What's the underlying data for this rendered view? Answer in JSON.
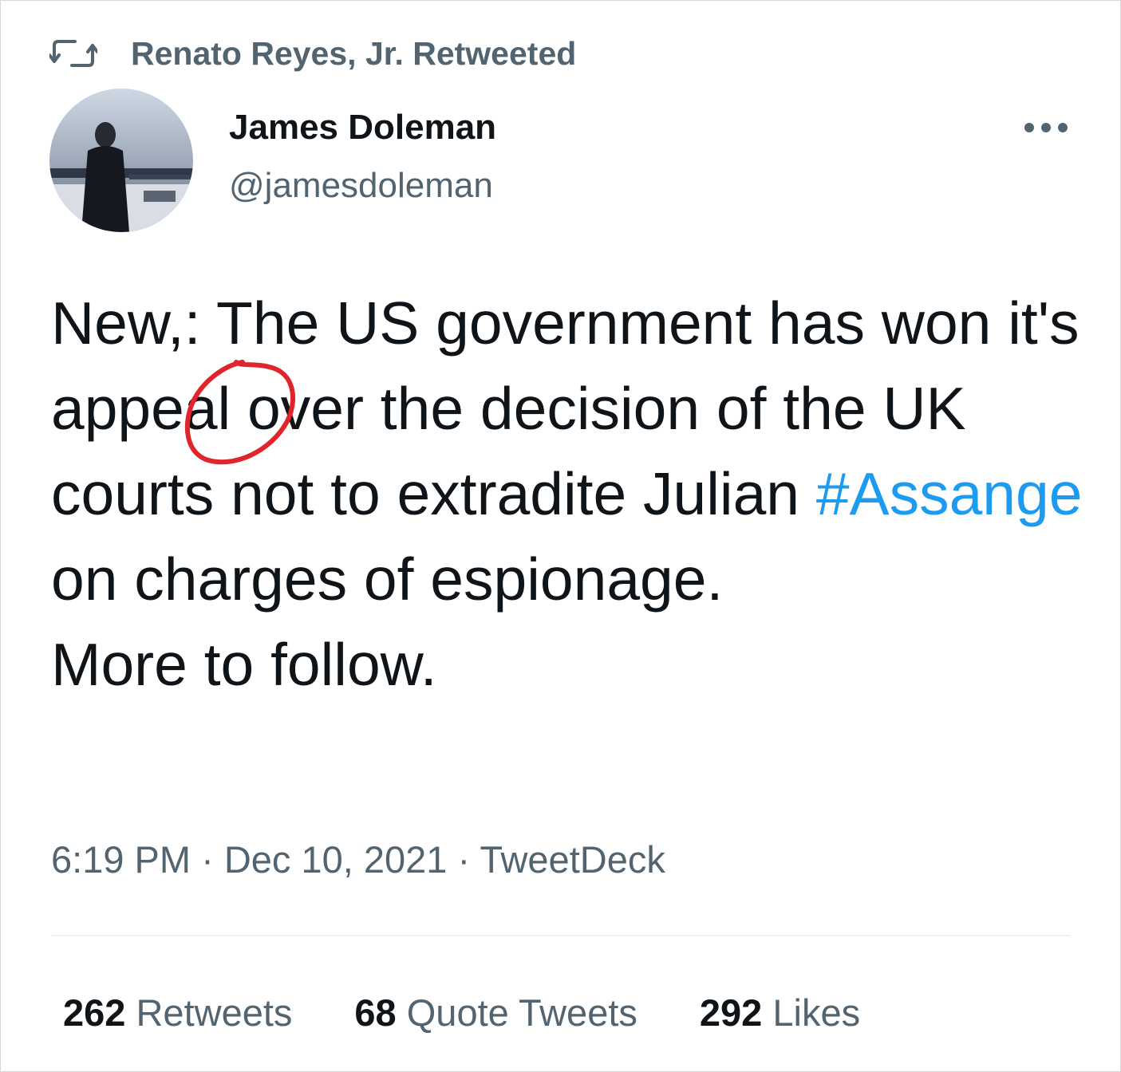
{
  "retweet": {
    "label": "Renato Reyes, Jr. Retweeted",
    "icon": "retweet-icon"
  },
  "author": {
    "name": "James Doleman",
    "handle": "@jamesdoleman"
  },
  "tweet": {
    "text_before_hashtag": "New,: The US government has won ",
    "highlighted_word": "it's",
    "text_after_highlight": " appeal over the decision of the UK courts not to extradite Julian ",
    "hashtag": "#Assange",
    "text_after_hashtag": " on charges of espionage.",
    "line2": "More to follow."
  },
  "meta": {
    "time": "6:19 PM",
    "date": "Dec 10, 2021",
    "source": "TweetDeck",
    "separator": "·"
  },
  "stats": [
    {
      "count": "262",
      "label": "Retweets"
    },
    {
      "count": "68",
      "label": "Quote Tweets"
    },
    {
      "count": "292",
      "label": "Likes"
    }
  ],
  "colors": {
    "link": "#1d9bf0",
    "secondary": "#536471",
    "annotation": "#e0242b"
  }
}
